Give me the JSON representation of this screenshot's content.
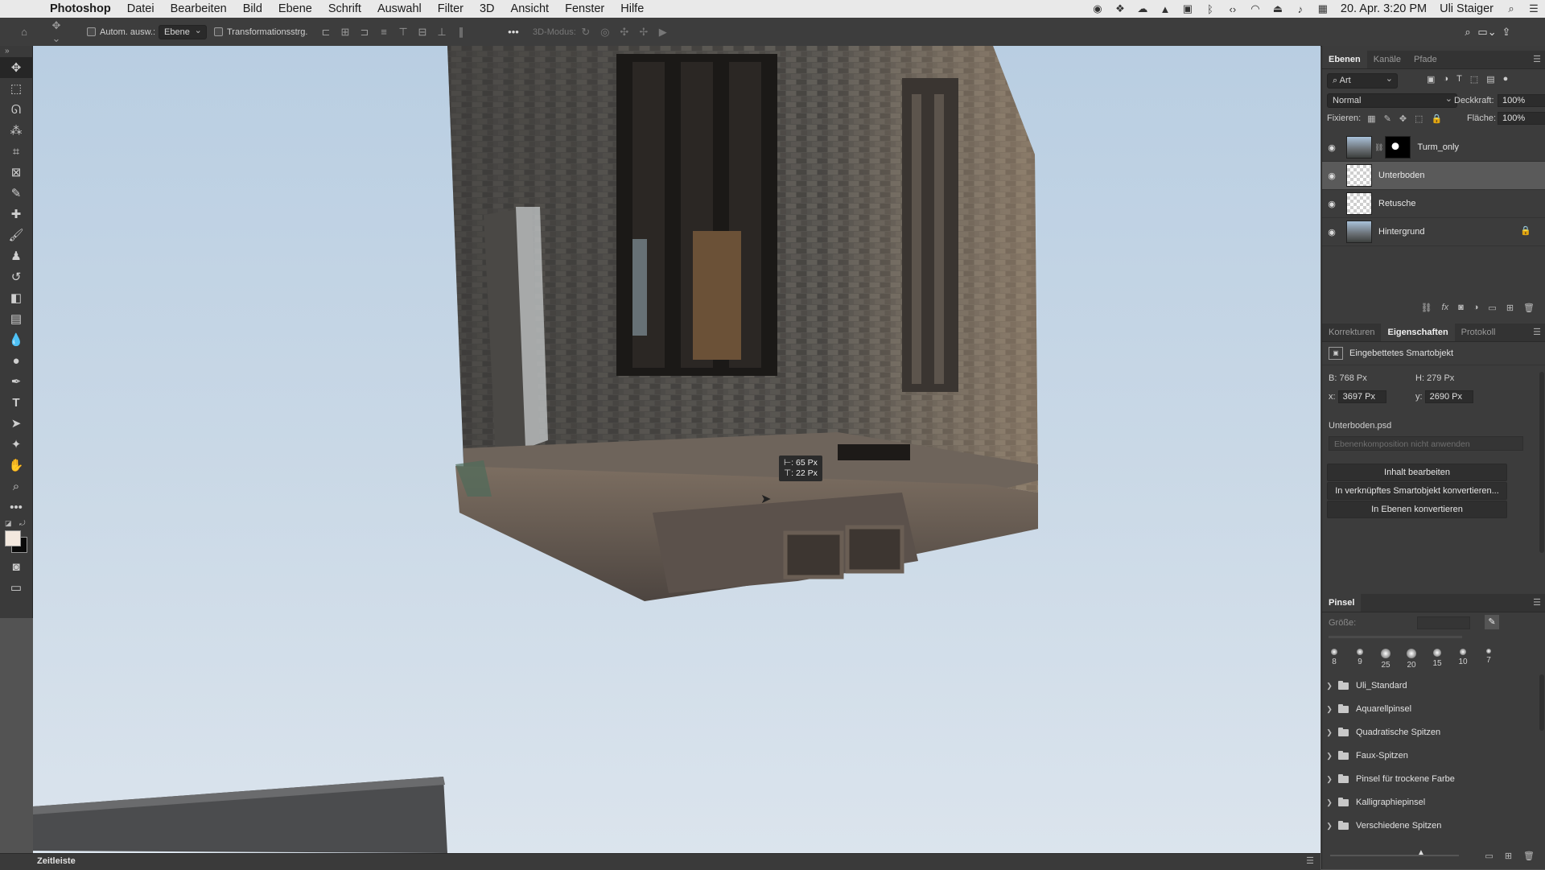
{
  "menubar": {
    "app": "Photoshop",
    "items": [
      "Datei",
      "Bearbeiten",
      "Bild",
      "Ebene",
      "Schrift",
      "Auswahl",
      "Filter",
      "3D",
      "Ansicht",
      "Fenster",
      "Hilfe"
    ],
    "clock": "20. Apr.  3:20 PM",
    "user": "Uli Staiger"
  },
  "options": {
    "auto_select_label": "Autom. ausw.:",
    "auto_select_value": "Ebene",
    "transform_label": "Transformationsstrg.",
    "mode3d_label": "3D-Modus:"
  },
  "canvas": {
    "tooltip_line1": "⊢: 65 Px",
    "tooltip_line2": "⊤: 22 Px"
  },
  "timeline": {
    "label": "Zeitleiste"
  },
  "layers_panel": {
    "tabs": [
      "Ebenen",
      "Kanäle",
      "Pfade"
    ],
    "filter_value": "Art",
    "blend_mode": "Normal",
    "opacity_label": "Deckkraft:",
    "opacity_value": "100%",
    "lock_label": "Fixieren:",
    "fill_label": "Fläche:",
    "fill_value": "100%",
    "layers": [
      {
        "name": "Turm_only"
      },
      {
        "name": "Unterboden"
      },
      {
        "name": "Retusche"
      },
      {
        "name": "Hintergrund"
      }
    ]
  },
  "properties_panel": {
    "tabs": [
      "Korrekturen",
      "Eigenschaften",
      "Protokoll"
    ],
    "type_label": "Eingebettetes Smartobjekt",
    "w_label": "B:",
    "w_value": "768 Px",
    "h_label": "H:",
    "h_value": "279 Px",
    "x_label": "x:",
    "x_value": "3697 Px",
    "y_label": "y:",
    "y_value": "2690 Px",
    "filename": "Unterboden.psd",
    "comp_placeholder": "Ebenenkomposition nicht anwenden",
    "btn_edit": "Inhalt bearbeiten",
    "btn_convert_linked": "In verknüpftes Smartobjekt konvertieren...",
    "btn_convert_layers": "In Ebenen konvertieren"
  },
  "brush_panel": {
    "title": "Pinsel",
    "size_label": "Größe:",
    "sizes": [
      "8",
      "9",
      "25",
      "20",
      "15",
      "10",
      "7"
    ],
    "groups": [
      "Uli_Standard",
      "Aquarellpinsel",
      "Quadratische Spitzen",
      "Faux-Spitzen",
      "Pinsel für trockene Farbe",
      "Kalligraphiepinsel",
      "Verschiedene Spitzen"
    ]
  },
  "colors": {
    "foreground": "#f3e8de",
    "background": "#0a0a0a",
    "panel_bg": "#3c3c3c",
    "selected_layer": "#5a5a5a"
  }
}
